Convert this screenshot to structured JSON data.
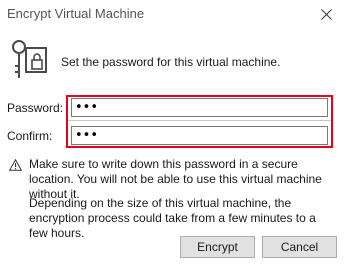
{
  "window": {
    "title": "Encrypt Virtual Machine",
    "close_icon": "close-icon"
  },
  "header": {
    "icon": "key-lock-icon",
    "text": "Set the password for this virtual machine."
  },
  "form": {
    "password_label": "Password:",
    "password_value": "•••",
    "confirm_label": "Confirm:",
    "confirm_value": "•••",
    "highlight_color": "#e8001c"
  },
  "messages": {
    "warning_icon": "warning-triangle-icon",
    "warning_text": "Make sure to write down this password in a secure location. You will not be able to use this virtual machine without it.",
    "info_text": "Depending on the size of this virtual machine, the encryption process could take from a few minutes to a few hours."
  },
  "buttons": {
    "encrypt_label": "Encrypt",
    "cancel_label": "Cancel"
  }
}
